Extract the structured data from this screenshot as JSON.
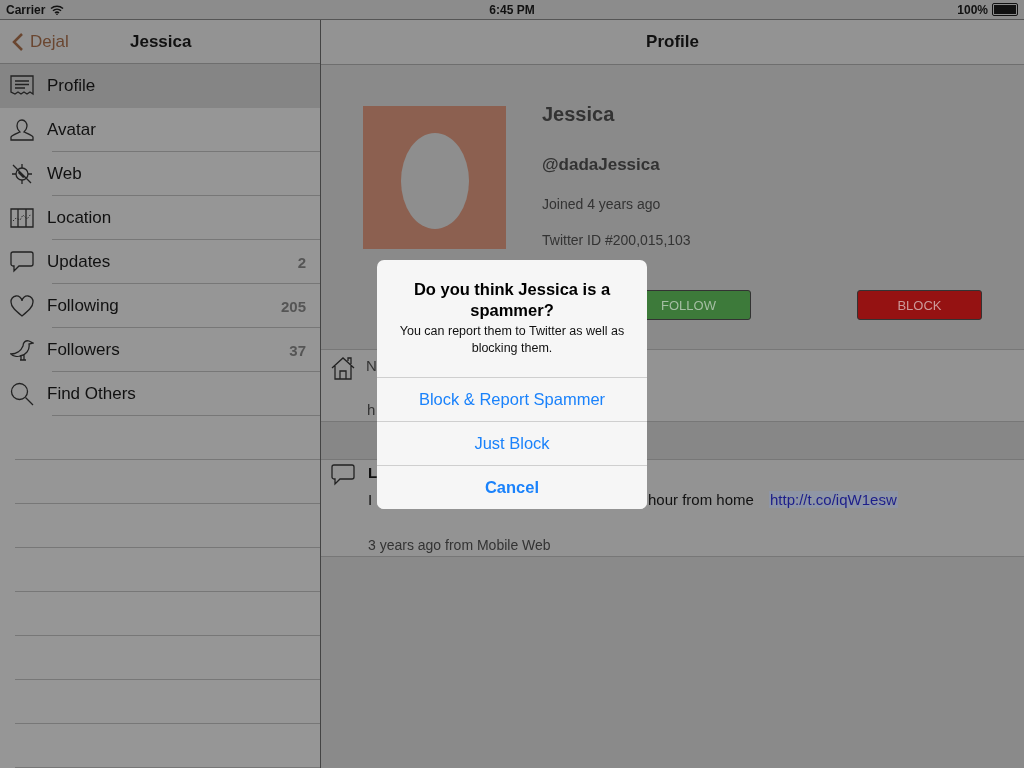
{
  "status_bar": {
    "carrier": "Carrier",
    "time": "6:45 PM",
    "battery": "100%"
  },
  "sidebar": {
    "back": "Dejal",
    "title": "Jessica",
    "items": [
      {
        "label": "Profile",
        "selected": true
      },
      {
        "label": "Avatar",
        "selected": false
      },
      {
        "label": "Web",
        "selected": false
      },
      {
        "label": "Location",
        "selected": false
      },
      {
        "label": "Updates",
        "count": "2",
        "selected": false
      },
      {
        "label": "Following",
        "count": "205",
        "selected": false
      },
      {
        "label": "Followers",
        "count": "37",
        "selected": false
      },
      {
        "label": "Find Others",
        "selected": false
      }
    ]
  },
  "detail": {
    "title": "Profile",
    "name": "Jessica",
    "handle": "@dadaJessica",
    "joined": "Joined 4 years ago",
    "twitter_id": "Twitter ID #200,015,103",
    "buttons": [
      {
        "label": "FOLLOW",
        "kind": "follow"
      },
      {
        "label": "BLOCK",
        "kind": "block"
      }
    ],
    "bio": "N",
    "url": "h",
    "update": {
      "title": "L",
      "text_start": "I",
      "text_end": "hour from home",
      "link": "http://t.co/iqW1esw",
      "meta": "3 years ago from Mobile Web"
    }
  },
  "alert": {
    "title": "Do you think Jessica is a spammer?",
    "message": "You can report them to Twitter as well as blocking them.",
    "actions": [
      {
        "label": "Block & Report Spammer",
        "kind": "default"
      },
      {
        "label": "Just Block",
        "kind": "default"
      },
      {
        "label": "Cancel",
        "kind": "cancel"
      }
    ]
  }
}
